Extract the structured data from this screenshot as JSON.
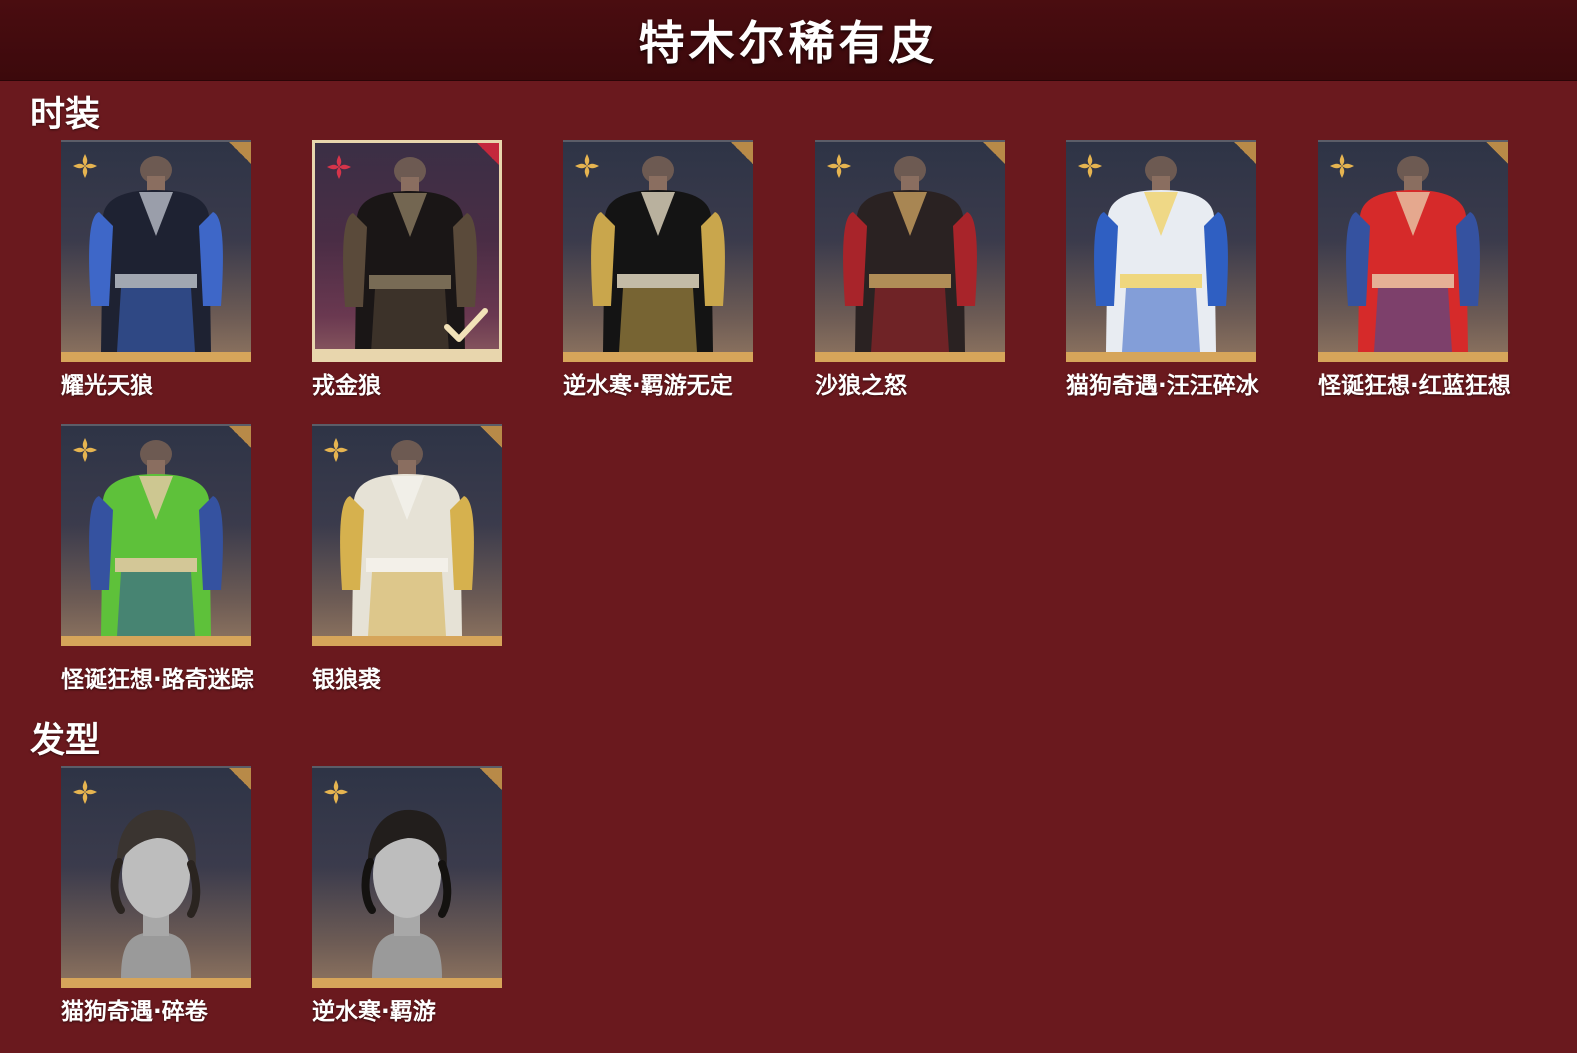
{
  "header": {
    "title": "特木尔稀有皮"
  },
  "sections": [
    {
      "title": "时装",
      "items": [
        {
          "label": "耀光天狼",
          "selected": false,
          "colors": {
            "main": "#1e2232",
            "accent": "#3e67c8",
            "trim": "#b9bec8"
          }
        },
        {
          "label": "戎金狼",
          "selected": true,
          "colors": {
            "main": "#1a1616",
            "accent": "#5a4a3a",
            "trim": "#8a7a60"
          }
        },
        {
          "label": "逆水寒·羁游无定",
          "selected": false,
          "colors": {
            "main": "#141414",
            "accent": "#c9a64c",
            "trim": "#e2d8c0"
          }
        },
        {
          "label": "沙狼之怒",
          "selected": false,
          "colors": {
            "main": "#2a2222",
            "accent": "#a8242a",
            "trim": "#c8a060"
          }
        },
        {
          "label": "猫狗奇遇·汪汪碎冰",
          "selected": false,
          "colors": {
            "main": "#e8ecf2",
            "accent": "#2f5fc2",
            "trim": "#f0d36a"
          }
        },
        {
          "label": "怪诞狂想·红蓝狂想",
          "selected": false,
          "colors": {
            "main": "#d62a2a",
            "accent": "#3552a0",
            "trim": "#e8c8a8"
          }
        },
        {
          "label": "怪诞狂想·路奇迷踪",
          "selected": false,
          "colors": {
            "main": "#5ec13a",
            "accent": "#3552a0",
            "trim": "#e8c8a8"
          }
        },
        {
          "label": "银狼裘",
          "selected": false,
          "colors": {
            "main": "#e6e2d6",
            "accent": "#d6b14e",
            "trim": "#f4f2ec"
          }
        }
      ]
    },
    {
      "title": "发型",
      "items": [
        {
          "label": "猫狗奇遇·碎卷",
          "selected": false,
          "colors": {
            "main": "#3a3430",
            "accent": "#bdbdbd",
            "trim": "#2a2420"
          }
        },
        {
          "label": "逆水寒·羁游",
          "selected": false,
          "colors": {
            "main": "#221e1c",
            "accent": "#bdbdbd",
            "trim": "#141210"
          }
        }
      ]
    }
  ],
  "icons": {
    "rarity": "four-petal-flower-icon",
    "corner": "corner-fold-icon",
    "selected": "checkmark-icon"
  }
}
